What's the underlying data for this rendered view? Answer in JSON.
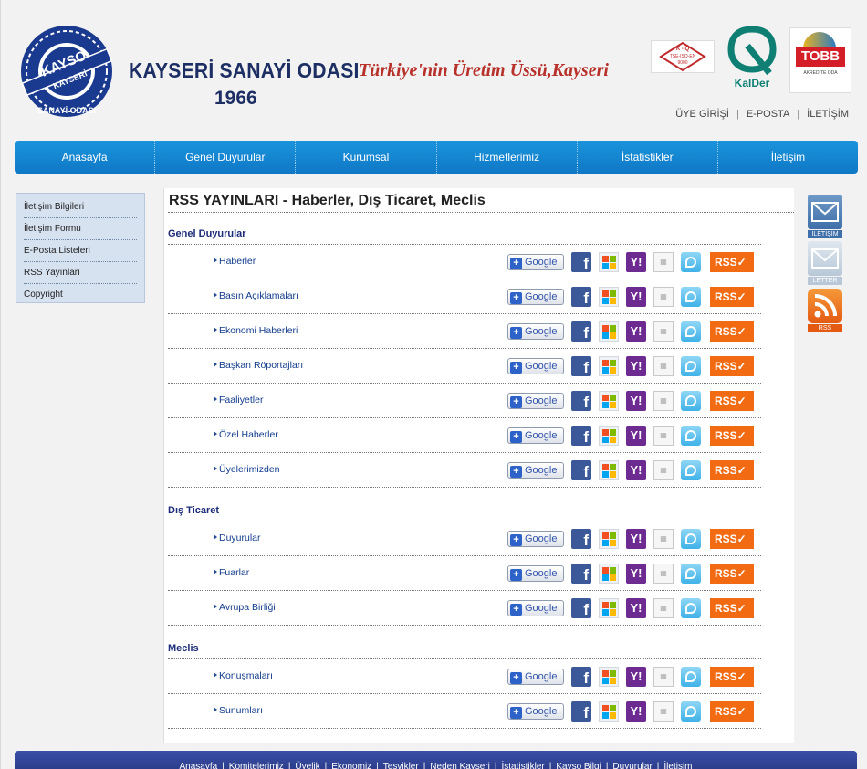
{
  "header": {
    "logo_ring_text": "KAYSO",
    "logo_band_text": "KAYSERİ",
    "logo_bottom_text": "SANAYİ ODASI",
    "org_name": "KAYSERİ SANAYİ ODASI",
    "org_year": "1966",
    "slogan": "Türkiye'nin Üretim Üssü,Kayseri",
    "cert_kq_top": "K - Q",
    "cert_kq_mid": "TSE-ISO-EN",
    "cert_kq_bottom": "9000",
    "cert_kalder": "KalDer",
    "cert_tobb": "TOBB",
    "cert_tobb_sub": "AKREDİTE ODA"
  },
  "toplinks": [
    "ÜYE GİRİŞİ",
    "E-POSTA",
    "İLETİŞİM"
  ],
  "nav": [
    "Anasayfa",
    "Genel Duyurular",
    "Kurumsal",
    "Hizmetlerimiz",
    "İstatistikler",
    "İletişim"
  ],
  "sidebar": [
    "İletişim Bilgileri",
    "İletişim Formu",
    "E-Posta Listeleri",
    "RSS Yayınları",
    "Copyright"
  ],
  "main": {
    "title": "RSS YAYINLARI - Haberler, Dış Ticaret, Meclis",
    "sections": [
      {
        "title": "Genel Duyurular",
        "items": [
          "Haberler",
          "Basın Açıklamaları",
          "Ekonomi Haberleri",
          "Başkan Röportajları",
          "Faaliyetler",
          "Özel Haberler",
          "Üyelerimizden"
        ]
      },
      {
        "title": "Dış Ticaret",
        "items": [
          "Duyurular",
          "Fuarlar",
          "Avrupa Birliği"
        ]
      },
      {
        "title": "Meclis",
        "items": [
          "Konuşmaları",
          "Sunumları"
        ]
      }
    ]
  },
  "buttons": {
    "google": "Google",
    "facebook": "f",
    "yahoo": "Y!",
    "rss": "RSS✓"
  },
  "right_icons": [
    "İLETİŞİM",
    "LETTER",
    "RSS"
  ],
  "footer": [
    "Anasayfa",
    "Komitelerimiz",
    "Üyelik",
    "Ekonomiz",
    "Teşvikler",
    "Neden Kayseri",
    "İstatistikler",
    "Kayso Bilgi",
    "Duyurular",
    "İletişim"
  ],
  "colors": {
    "nav_blue": "#1588d2",
    "title_navy": "#1c2e63",
    "slogan_red": "#b8302a",
    "rss_orange": "#f26b12",
    "footer_blue": "#2f429a"
  }
}
